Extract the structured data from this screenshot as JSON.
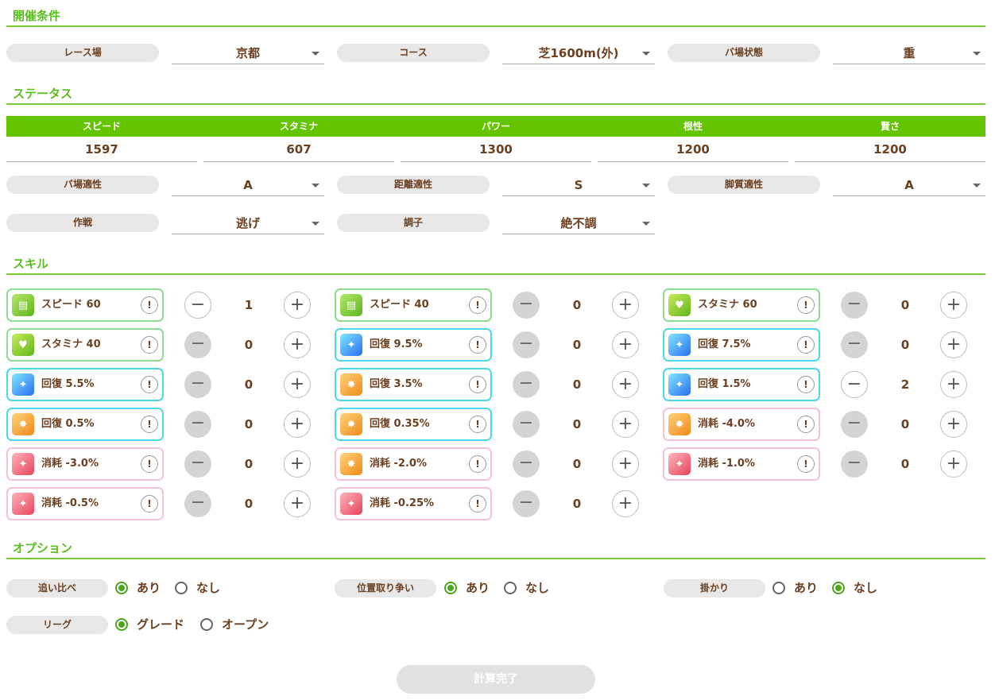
{
  "sections": {
    "conditions": "開催条件",
    "status": "ステータス",
    "skills": "スキル",
    "options": "オプション"
  },
  "conditions": {
    "racecourse_label": "レース場",
    "racecourse_value": "京都",
    "course_label": "コース",
    "course_value": "芝1600m(外)",
    "ground_label": "バ場状態",
    "ground_value": "重"
  },
  "status": {
    "headers": [
      "スピード",
      "スタミナ",
      "パワー",
      "根性",
      "賢さ"
    ],
    "values": [
      "1597",
      "607",
      "1300",
      "1200",
      "1200"
    ],
    "ground_apt_label": "バ場適性",
    "ground_apt_value": "A",
    "distance_apt_label": "距離適性",
    "distance_apt_value": "S",
    "style_apt_label": "脚質適性",
    "style_apt_value": "A",
    "strategy_label": "作戦",
    "strategy_value": "逃げ",
    "condition_label": "調子",
    "condition_value": "絶不調"
  },
  "skills": [
    {
      "name": "スピード 60",
      "count": "1",
      "border": "green",
      "icon": "speed-card-icon"
    },
    {
      "name": "スピード 40",
      "count": "0",
      "border": "green",
      "icon": "speed-card-icon"
    },
    {
      "name": "スタミナ 60",
      "count": "0",
      "border": "green",
      "icon": "heart-icon"
    },
    {
      "name": "スタミナ 40",
      "count": "0",
      "border": "green",
      "icon": "heart-icon"
    },
    {
      "name": "回復 9.5%",
      "count": "0",
      "border": "cyan",
      "icon": "sparkle-icon"
    },
    {
      "name": "回復 7.5%",
      "count": "0",
      "border": "cyan",
      "icon": "sparkle-icon"
    },
    {
      "name": "回復 5.5%",
      "count": "0",
      "border": "cyan",
      "icon": "sparkle-icon"
    },
    {
      "name": "回復 3.5%",
      "count": "0",
      "border": "cyan",
      "icon": "runner-icon"
    },
    {
      "name": "回復 1.5%",
      "count": "2",
      "border": "cyan",
      "icon": "sparkle-icon"
    },
    {
      "name": "回復 0.5%",
      "count": "0",
      "border": "cyan",
      "icon": "runner-icon"
    },
    {
      "name": "回復 0.35%",
      "count": "0",
      "border": "cyan",
      "icon": "runner-icon"
    },
    {
      "name": "消耗 -4.0%",
      "count": "0",
      "border": "pink",
      "icon": "runner-icon"
    },
    {
      "name": "消耗 -3.0%",
      "count": "0",
      "border": "pink",
      "icon": "sparkle-red-icon"
    },
    {
      "name": "消耗 -2.0%",
      "count": "0",
      "border": "pink",
      "icon": "runner-icon"
    },
    {
      "name": "消耗 -1.0%",
      "count": "0",
      "border": "pink",
      "icon": "sparkle-red-icon"
    },
    {
      "name": "消耗 -0.5%",
      "count": "0",
      "border": "pink",
      "icon": "sparkle-red-icon"
    },
    {
      "name": "消耗 -0.25%",
      "count": "0",
      "border": "pink",
      "icon": "sparkle-red-icon"
    }
  ],
  "options": {
    "chase_label": "追い比べ",
    "position_label": "位置取り争い",
    "pace_label": "掛かり",
    "league_label": "リーグ",
    "yes": "あり",
    "no": "なし",
    "grade": "グレード",
    "open": "オープン"
  },
  "submit_label": "計算完了",
  "colors": {
    "accent_green": "#64c400",
    "text_brown": "#6b3f1f"
  }
}
